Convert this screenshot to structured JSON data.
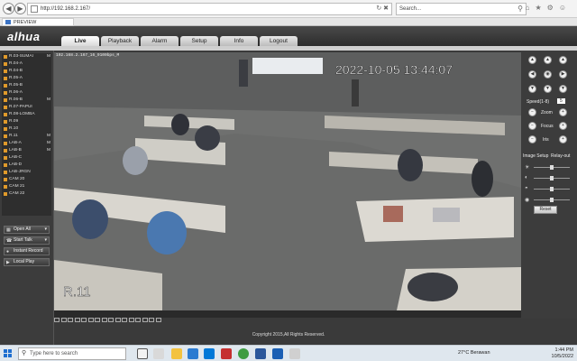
{
  "browser": {
    "url": "http://192.168.2.167/",
    "search_placeholder": "Search...",
    "tab_title": "PREVIEW"
  },
  "app": {
    "logo": "alhua",
    "nav_tabs": [
      "Live",
      "Playback",
      "Alarm",
      "Setup",
      "Info",
      "Logout"
    ],
    "active_tab": "Live",
    "cameras": [
      {
        "name": "R.03-SUMAI",
        "m": "M"
      },
      {
        "name": "R.04-A",
        "m": ""
      },
      {
        "name": "R.04-B",
        "m": ""
      },
      {
        "name": "R.05-A",
        "m": ""
      },
      {
        "name": "R.05-B",
        "m": ""
      },
      {
        "name": "R.06-A",
        "m": ""
      },
      {
        "name": "R.06-B",
        "m": "M"
      },
      {
        "name": "R.07-PAPUI",
        "m": ""
      },
      {
        "name": "R.08-LOMBA",
        "m": ""
      },
      {
        "name": "R.09",
        "m": ""
      },
      {
        "name": "R.10",
        "m": ""
      },
      {
        "name": "R.11",
        "m": "M"
      },
      {
        "name": "LAB-A",
        "m": "M"
      },
      {
        "name": "LAB-B",
        "m": "M"
      },
      {
        "name": "LAB-C",
        "m": ""
      },
      {
        "name": "LAB-D",
        "m": ""
      },
      {
        "name": "LAB-JRGN",
        "m": ""
      },
      {
        "name": "CAM 20",
        "m": ""
      },
      {
        "name": "CAM 21",
        "m": ""
      },
      {
        "name": "CAM 22",
        "m": ""
      }
    ],
    "left_buttons": {
      "open_all": "Open All",
      "start_talk": "Start Talk",
      "instant_record": "Instant Record",
      "local_play": "Local Play"
    },
    "video": {
      "stream_info": "192.168.2.167_16_9100bps_M",
      "timestamp": "2022-10-05 13:44:07",
      "channel_name": "R.11"
    },
    "ptz": {
      "speed_label": "Speed(1-8)",
      "speed_value": "5",
      "zoom": "Zoom",
      "focus": "Focus",
      "iris": "Iris"
    },
    "image_setup": {
      "title": "Image Setup",
      "relay_out": "Relay-out",
      "brightness": 0.5,
      "contrast": 0.5,
      "saturation": 0.5,
      "hue": 0.5,
      "reset": "Reset"
    },
    "footer": "Copyright 2015,All Rights Reserved."
  },
  "taskbar": {
    "search_placeholder": "Type here to search",
    "weather": "27°C  Berawan",
    "time": "1:44 PM",
    "date": "10/5/2022"
  }
}
